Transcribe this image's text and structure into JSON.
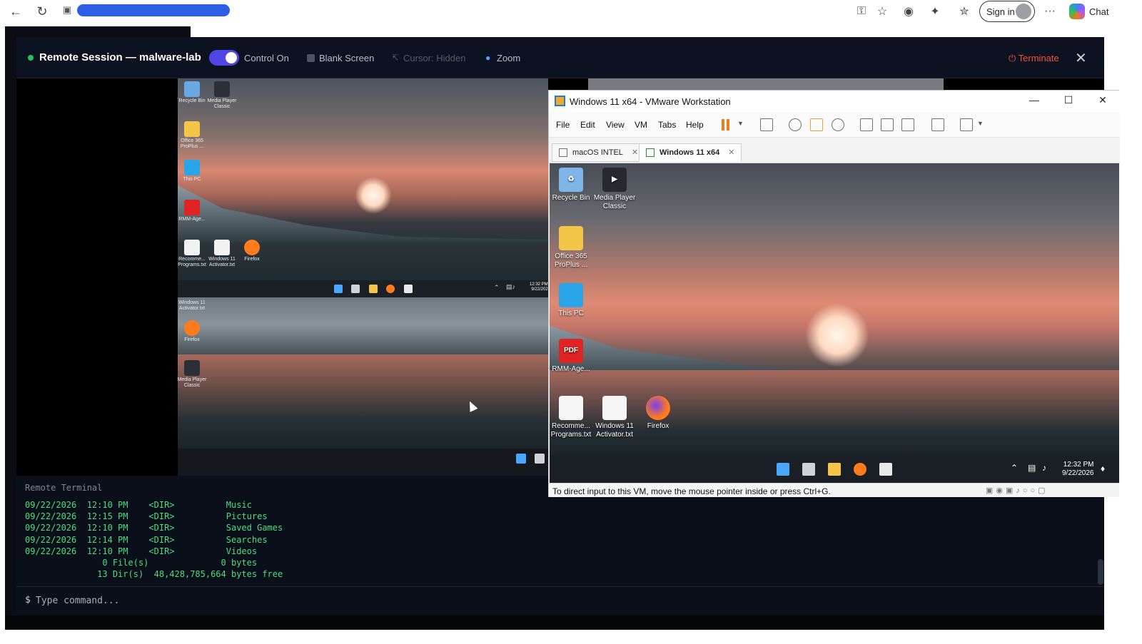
{
  "browser": {
    "signin_label": "Sign in",
    "chat_label": "Chat",
    "more_label": "···"
  },
  "session": {
    "title": "Remote Session — malware-lab",
    "control_label": "Control On",
    "control_on": true,
    "blank_screen_label": "Blank Screen",
    "cursor_label": "Cursor: Hidden",
    "zoom_label": "Zoom",
    "terminate_label": "Terminate",
    "status_color": "#22c55e",
    "accent": "#4f46e5"
  },
  "remote_mini": {
    "icons_top": [
      {
        "label": "Recycle Bin"
      },
      {
        "label": "Media Player Classic"
      },
      {
        "label": "Office 365 ProPlus ..."
      },
      {
        "label": "This PC"
      },
      {
        "label": "RMM-Age..."
      },
      {
        "label": "Recomme... Programs.txt"
      },
      {
        "label": "Windows 11 Activator.txt"
      },
      {
        "label": "Firefox"
      }
    ],
    "clock_time": "12:32 PM",
    "clock_date": "9/22/202",
    "icons_bottom": [
      {
        "label": "Windows 11 Activator.txt"
      },
      {
        "label": "Firefox"
      },
      {
        "label": "Media Player Classic"
      }
    ]
  },
  "vmware": {
    "title": "Windows 11 x64 - VMware Workstation",
    "menu": [
      "File",
      "Edit",
      "View",
      "VM",
      "Tabs",
      "Help"
    ],
    "tabs": [
      {
        "label": "macOS INTEL",
        "active": false
      },
      {
        "label": "Windows 11 x64",
        "active": true
      }
    ],
    "desktop_icons": [
      {
        "label": "Recycle Bin",
        "icon": "recycle-bin-icon"
      },
      {
        "label": "Media Player Classic",
        "icon": "media-player-icon"
      },
      {
        "label": "Office 365 ProPlus ...",
        "icon": "folder-icon"
      },
      {
        "label": "This PC",
        "icon": "monitor-icon"
      },
      {
        "label": "RMM-Age...",
        "icon": "pdf-icon",
        "glyph": "PDF"
      },
      {
        "label": "Recomme... Programs.txt",
        "icon": "text-file-icon"
      },
      {
        "label": "Windows 11 Activator.txt",
        "icon": "text-file-icon"
      },
      {
        "label": "Firefox",
        "icon": "firefox-icon"
      }
    ],
    "clock_time": "12:32 PM",
    "clock_date": "9/22/2026",
    "status_text": "To direct input to this VM, move the mouse pointer inside or press Ctrl+G."
  },
  "terminal": {
    "title": "Remote Terminal",
    "lines": [
      "09/22/2026  12:10 PM    <DIR>          Music",
      "09/22/2026  12:15 PM    <DIR>          Pictures",
      "09/22/2026  12:10 PM    <DIR>          Saved Games",
      "09/22/2026  12:14 PM    <DIR>          Searches",
      "09/22/2026  12:10 PM    <DIR>          Videos",
      "               0 File(s)              0 bytes",
      "              13 Dir(s)  48,428,785,664 bytes free"
    ],
    "prompt": "$",
    "placeholder": "Type command..."
  }
}
